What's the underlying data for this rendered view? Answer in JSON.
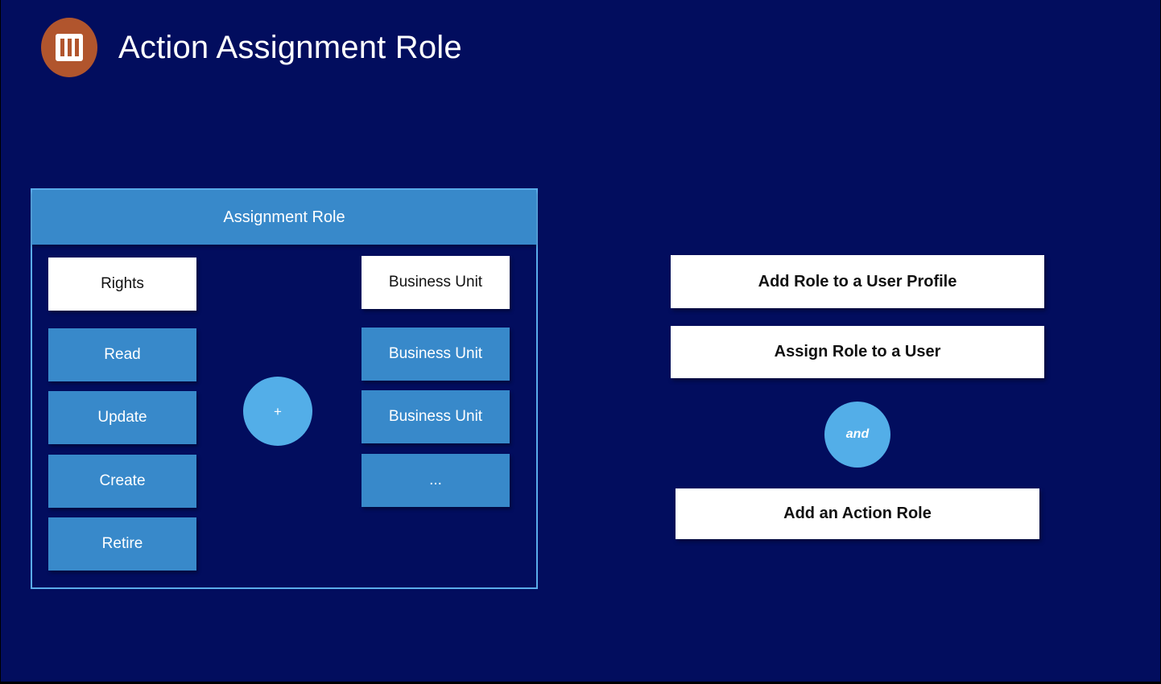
{
  "header": {
    "title": "Action Assignment Role",
    "icon": "pillar-building-icon"
  },
  "colors": {
    "background": "#020d5e",
    "panel_border": "#5aaceb",
    "tile_blue": "#3889ca",
    "circle_blue": "#53aee8",
    "icon_orange": "#b1552d",
    "white": "#ffffff"
  },
  "assignment_panel": {
    "header_label": "Assignment Role",
    "rights_column": {
      "heading": "Rights",
      "items": [
        "Read",
        "Update",
        "Create",
        "Retire"
      ]
    },
    "operator": "+",
    "business_unit_column": {
      "heading": "Business Unit",
      "items": [
        "Business Unit",
        "Business Unit",
        "..."
      ]
    }
  },
  "action_steps": {
    "steps": [
      "Add Role to a User Profile",
      "Assign Role to a User"
    ],
    "connector": "and",
    "final_step": "Add an Action Role"
  }
}
